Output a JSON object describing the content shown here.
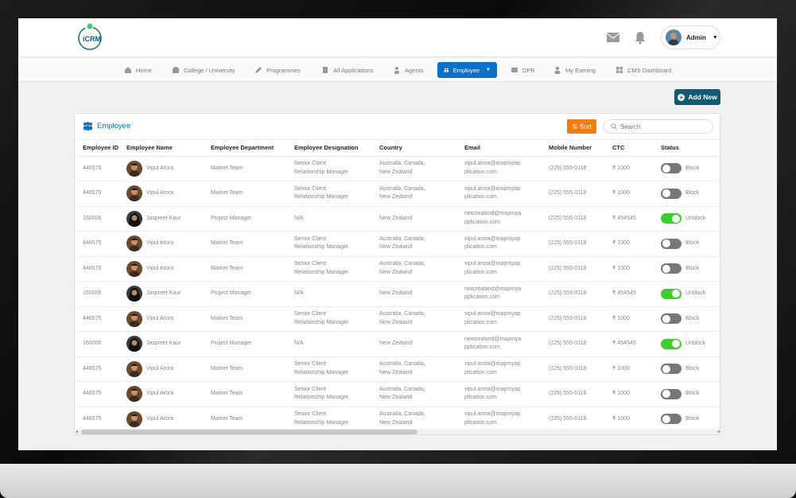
{
  "header": {
    "logo_text": "iCRM",
    "user_name": "Admin"
  },
  "nav": {
    "items": [
      {
        "label": "Home"
      },
      {
        "label": "College / University"
      },
      {
        "label": "Programmes"
      },
      {
        "label": "All Applications"
      },
      {
        "label": "Agents"
      },
      {
        "label": "Employee"
      },
      {
        "label": "DPR"
      },
      {
        "label": "My Earning"
      },
      {
        "label": "CMS Dashboard"
      }
    ]
  },
  "actions": {
    "add_new": "Add New"
  },
  "card": {
    "title": "Employee",
    "sort_label": "Sort",
    "search_placeholder": "Search"
  },
  "table": {
    "headers": {
      "id": "Employee ID",
      "name": "Employee Name",
      "dept": "Employee Department",
      "desig": "Employee Designation",
      "country": "Country",
      "email": "Email",
      "mobile": "Mobile Number",
      "ctc": "CTC",
      "status": "Status"
    },
    "rows": [
      {
        "id": "446575",
        "name": "Vipul Arora",
        "dept": "Market Team",
        "desig1": "Senior Client",
        "desig2": "Relationship Manager",
        "country1": "Australia, Canada,",
        "country2": "New Zealand",
        "email1": "vipul.arora@mapmyap",
        "email2": "plication.com",
        "mobile": "(225) 555-0118",
        "ctc": "₹ 1000",
        "status": "Block",
        "on": false
      },
      {
        "id": "446575",
        "name": "Vipul Arora",
        "dept": "Market Team",
        "desig1": "Senior Client",
        "desig2": "Relationship Manager",
        "country1": "Australia, Canada,",
        "country2": "New Zealand",
        "email1": "vipul.arora@mapmyap",
        "email2": "plication.com",
        "mobile": "(225) 555-0118",
        "ctc": "₹ 1000",
        "status": "Block",
        "on": false
      },
      {
        "id": "160006",
        "name": "Jaspreet Kaur",
        "dept": "Project Manager",
        "desig1": "N/A",
        "desig2": "",
        "country1": "New Zealand",
        "country2": "",
        "email1": "newzealand@mapmya",
        "email2": "pplication.com",
        "mobile": "(225) 555-0118",
        "ctc": "₹ 454545",
        "status": "Unblock",
        "on": true
      },
      {
        "id": "446575",
        "name": "Vipul Arora",
        "dept": "Market Team",
        "desig1": "Senior Client",
        "desig2": "Relationship Manager",
        "country1": "Australia, Canada,",
        "country2": "New Zealand",
        "email1": "vipul.arora@mapmyap",
        "email2": "plication.com",
        "mobile": "(225) 555-0118",
        "ctc": "₹ 1000",
        "status": "Block",
        "on": false
      },
      {
        "id": "446575",
        "name": "Vipul Arora",
        "dept": "Market Team",
        "desig1": "Senior Client",
        "desig2": "Relationship Manager",
        "country1": "Australia, Canada,",
        "country2": "New Zealand",
        "email1": "vipul.arora@mapmyap",
        "email2": "plication.com",
        "mobile": "(225) 555-0118",
        "ctc": "₹ 1000",
        "status": "Block",
        "on": false
      },
      {
        "id": "160006",
        "name": "Jaspreet Kaur",
        "dept": "Project Manager",
        "desig1": "N/A",
        "desig2": "",
        "country1": "New Zealand",
        "country2": "",
        "email1": "newzealand@mapmya",
        "email2": "pplication.com",
        "mobile": "(225) 555-0118",
        "ctc": "₹ 454545",
        "status": "Unblock",
        "on": true
      },
      {
        "id": "446575",
        "name": "Vipul Arora",
        "dept": "Market Team",
        "desig1": "Senior Client",
        "desig2": "Relationship Manager",
        "country1": "Australia, Canada,",
        "country2": "New Zealand",
        "email1": "vipul.arora@mapmyap",
        "email2": "plication.com",
        "mobile": "(225) 555-0118",
        "ctc": "₹ 1000",
        "status": "Block",
        "on": false
      },
      {
        "id": "160006",
        "name": "Jaspreet Kaur",
        "dept": "Project Manager",
        "desig1": "N/A",
        "desig2": "",
        "country1": "New Zealand",
        "country2": "",
        "email1": "newzealand@mapmya",
        "email2": "pplication.com",
        "mobile": "(225) 555-0118",
        "ctc": "₹ 454545",
        "status": "Unblock",
        "on": true
      },
      {
        "id": "446575",
        "name": "Vipul Arora",
        "dept": "Market Team",
        "desig1": "Senior Client",
        "desig2": "Relationship Manager",
        "country1": "Australia, Canada,",
        "country2": "New Zealand",
        "email1": "vipul.arora@mapmyap",
        "email2": "plication.com",
        "mobile": "(225) 555-0118",
        "ctc": "₹ 1000",
        "status": "Block",
        "on": false
      },
      {
        "id": "446575",
        "name": "Vipul Arora",
        "dept": "Market Team",
        "desig1": "Senior Client",
        "desig2": "Relationship Manager",
        "country1": "Australia, Canada,",
        "country2": "New Zealand",
        "email1": "vipul.arora@mapmyap",
        "email2": "plication.com",
        "mobile": "(225) 555-0118",
        "ctc": "₹ 1000",
        "status": "Block",
        "on": false
      },
      {
        "id": "446575",
        "name": "Vipul Arora",
        "dept": "Market Team",
        "desig1": "Senior Client",
        "desig2": "Relationship Manager",
        "country1": "Australia, Canada,",
        "country2": "New Zealand",
        "email1": "vipul.arora@mapmyap",
        "email2": "plication.com",
        "mobile": "(225) 555-0118",
        "ctc": "₹ 1000",
        "status": "Block",
        "on": false
      }
    ]
  },
  "colors": {
    "accent": "#0c72c9",
    "sort": "#ef7d12",
    "add_new": "#135a73",
    "toggle_on": "#3fcc2f",
    "toggle_off": "#777777"
  }
}
